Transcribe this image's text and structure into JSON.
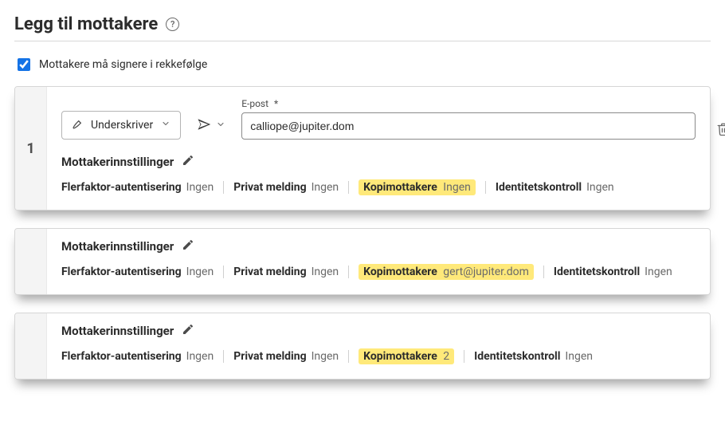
{
  "header": {
    "title": "Legg til mottakere"
  },
  "sign_order": {
    "label": "Mottakere må signere i rekkefølge",
    "checked": true
  },
  "recipient": {
    "index": "1",
    "role_label": "Underskriver",
    "email_label": "E-post",
    "email_required_mark": "*",
    "email_value": "calliope@jupiter.dom"
  },
  "settings_title": "Mottakerinnstillinger",
  "labels": {
    "mfa": "Flerfaktor-autentisering",
    "private_msg": "Privat melding",
    "cc": "Kopimottakere",
    "id_check": "Identitetskontroll",
    "none": "Ingen"
  },
  "card2": {
    "cc_value": "gert@jupiter.dom"
  },
  "card3": {
    "cc_value": "2"
  }
}
